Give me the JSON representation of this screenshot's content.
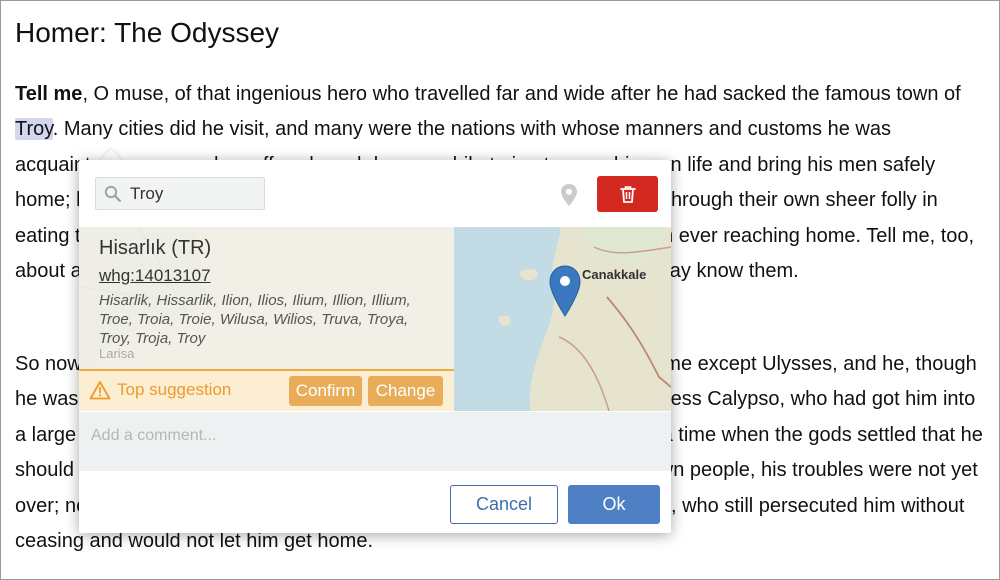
{
  "document": {
    "title": "Homer: The Odyssey",
    "paragraph1": {
      "lead": "Tell me",
      "before_highlight": ", O muse, of that ingenious hero who travelled far and wide after he had sacked the famous town of ",
      "highlight": "Troy",
      "after_highlight": ". Many cities did he visit, and many were the nations with whose manners and customs he was acquainted; moreover he suffered much by sea while trying to save his own life and bring his men safely home; but do what he might he could not save his men, for they perished through their own sheer folly in eating the cattle of the Sun-god Hyperion; so the god prevented them from ever reaching home. Tell me, too, about all these things, O daughter of Jove, from whatsoever source you may know them."
    },
    "paragraph2": "So now all who escaped death in battle or by shipwreck had got safely home except Ulysses, and he, though he was longing to return to his wife and country, was detained by the goddess Calypso, who had got him into a large cave and wanted to marry him. But as years went by, there came a time when the gods settled that he should go back to Ithaca; even then, however, when he was among his own people, his troubles were not yet over; nevertheless all the gods had now begun to pity him except Neptune, who still persecuted him without ceasing and would not let him get home."
  },
  "popup": {
    "search": {
      "value": "Troy"
    },
    "result": {
      "name": "Hisarlık (TR)",
      "id": "whg:14013107",
      "alt_names": "Hisarlik, Hissarlik, Ilion, Ilios, Ilium, Illion, Illium, Troe, Troia, Troie, Wilusa, Wilios, Truva, Troya, Troy, Troja, Troy",
      "map_labels": {
        "left": "Larisa",
        "right": "Canakkale"
      }
    },
    "suggestion": {
      "label": "Top suggestion",
      "confirm_label": "Confirm",
      "change_label": "Change"
    },
    "comment": {
      "placeholder": "Add a comment..."
    },
    "cancel_label": "Cancel",
    "ok_label": "Ok"
  },
  "colors": {
    "delete": "#d2281f",
    "ok": "#4f80c5",
    "cancel_border": "#3d6fab",
    "suggestion_text": "#ef9a2a",
    "suggestion_button": "#e9ad5a",
    "marker": "#3a78bf",
    "highlight": "#d2d6ef"
  },
  "icons": {
    "search": "search-icon",
    "pin": "location-pin-icon",
    "delete": "trash-icon",
    "warning": "warning-triangle-icon",
    "marker": "map-marker-icon"
  }
}
